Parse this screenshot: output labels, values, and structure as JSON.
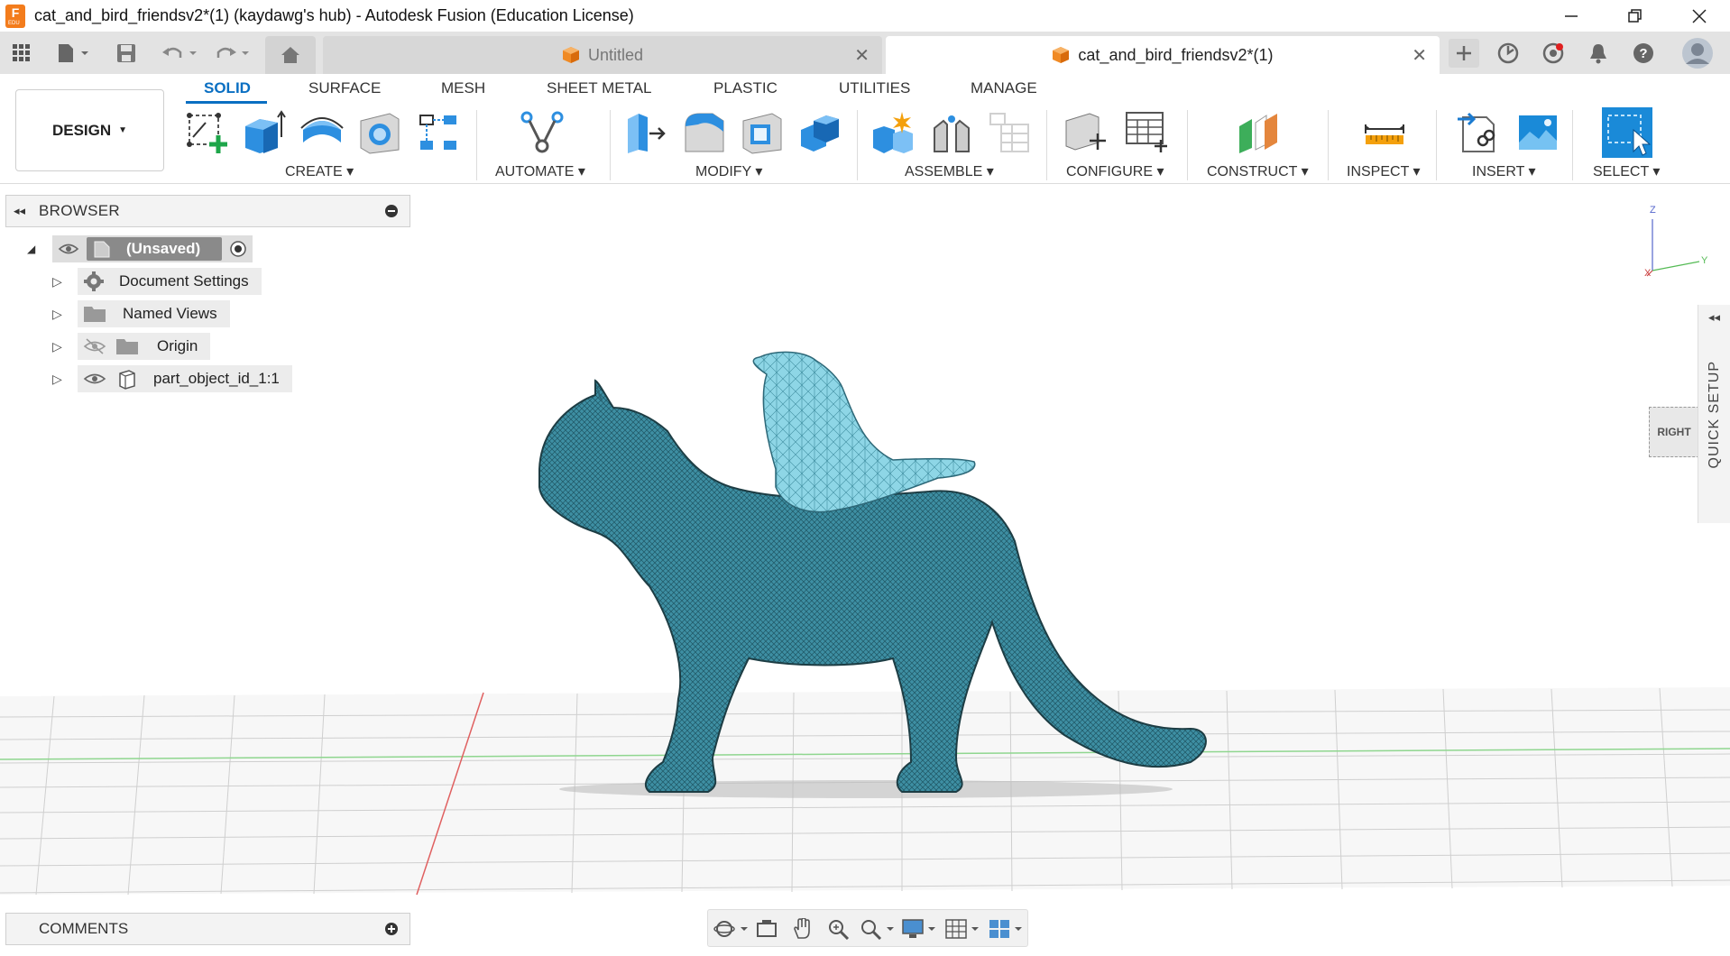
{
  "window": {
    "title": "cat_and_bird_friendsv2*(1) (kaydawg's hub) - Autodesk Fusion (Education License)",
    "app_badge": "F",
    "app_badge_sub": "EDU"
  },
  "tabs": {
    "untitled": "Untitled",
    "active": "cat_and_bird_friendsv2*(1)"
  },
  "workspace": {
    "label": "DESIGN"
  },
  "ribbon_tabs": [
    "SOLID",
    "SURFACE",
    "MESH",
    "SHEET METAL",
    "PLASTIC",
    "UTILITIES",
    "MANAGE"
  ],
  "groups": {
    "create": "CREATE",
    "automate": "AUTOMATE",
    "modify": "MODIFY",
    "assemble": "ASSEMBLE",
    "configure": "CONFIGURE",
    "construct": "CONSTRUCT",
    "inspect": "INSPECT",
    "insert": "INSERT",
    "select": "SELECT"
  },
  "browser": {
    "title": "BROWSER",
    "root": "(Unsaved)",
    "items": [
      "Document Settings",
      "Named Views",
      "Origin",
      "part_object_id_1:1"
    ]
  },
  "viewcube": {
    "face": "RIGHT",
    "axis_z": "Z",
    "axis_y": "Y",
    "axis_x": "X"
  },
  "quick_setup": "QUICK SETUP",
  "comments": "COMMENTS",
  "colors": {
    "accent": "#0a6fc2",
    "model": "#3e8fa3",
    "fusion_orange": "#f37c1c"
  }
}
